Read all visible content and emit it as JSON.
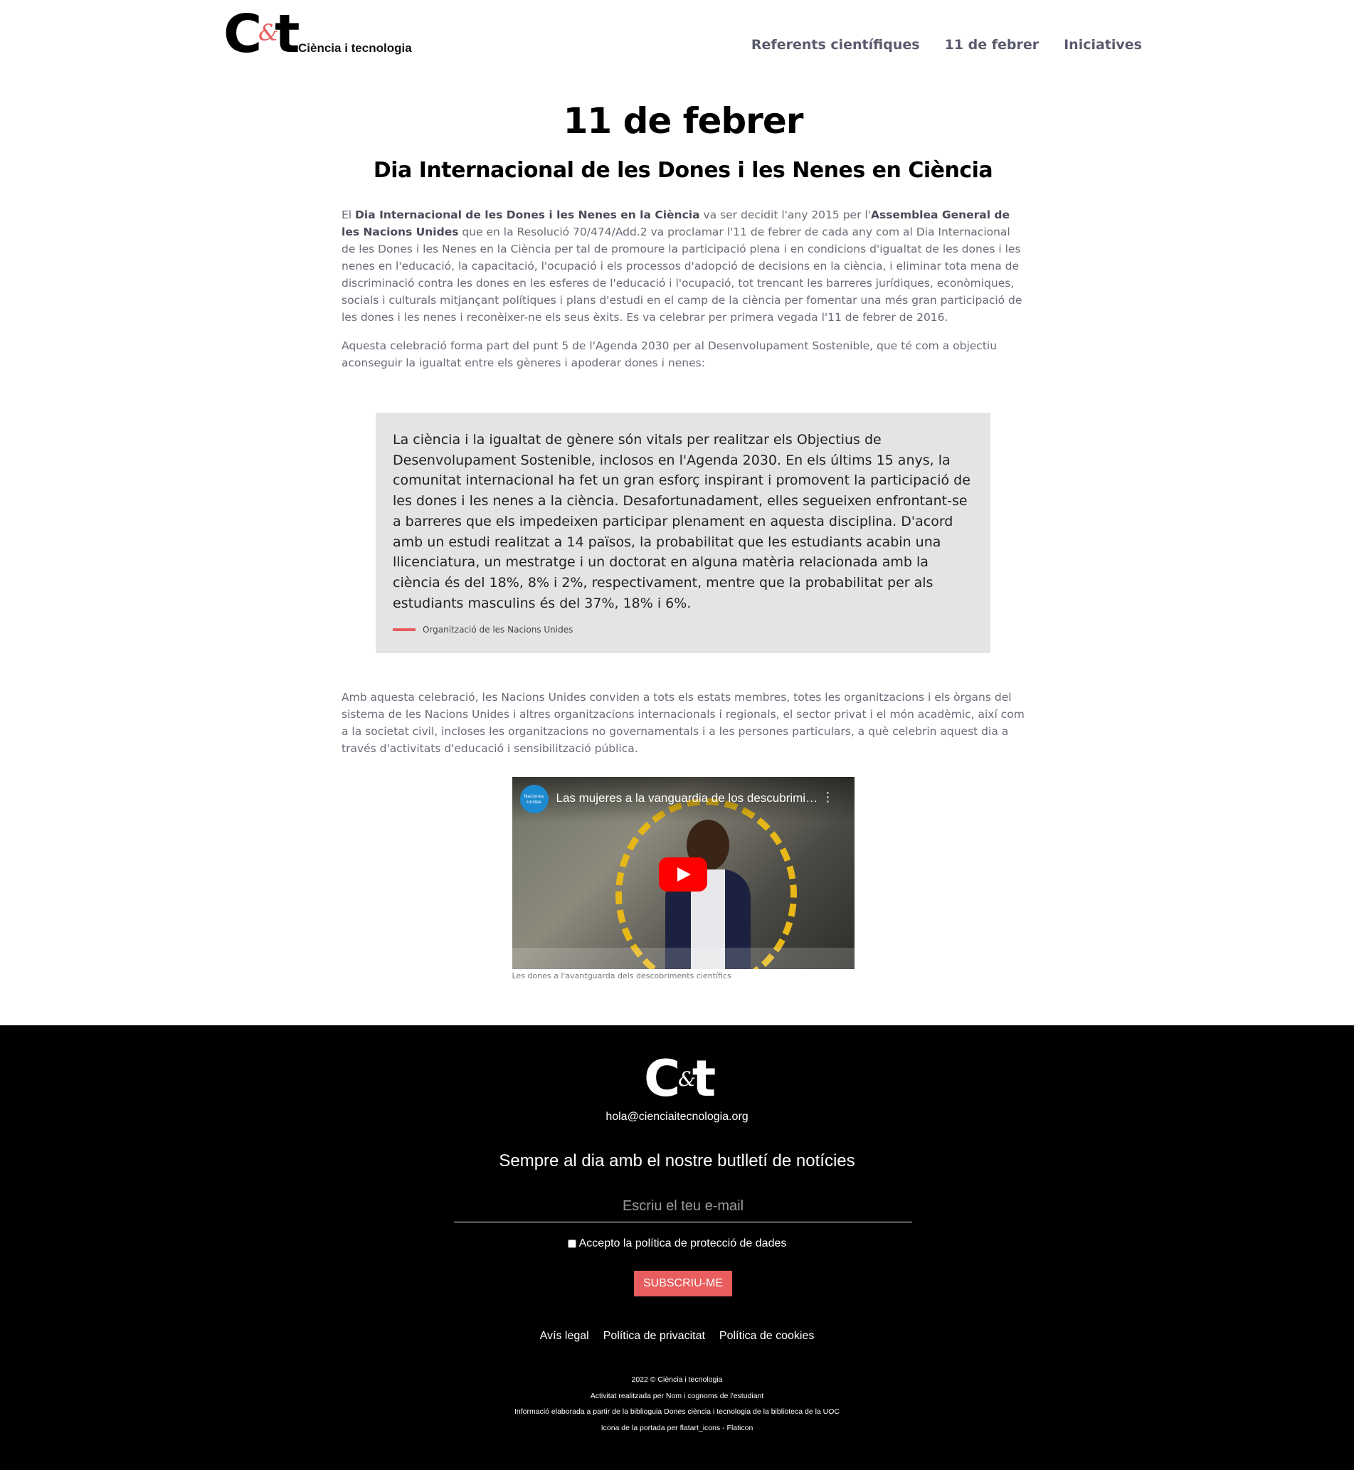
{
  "header": {
    "logo_text": "C&t",
    "logo_tagline": "Ciència i tecnologia",
    "nav": [
      {
        "label": "Referents científiques"
      },
      {
        "label": "11 de febrer"
      },
      {
        "label": "Iniciatives"
      }
    ]
  },
  "main": {
    "title": "11 de febrer",
    "subtitle": "Dia Internacional de les Dones i les Nenes en Ciència",
    "p1": {
      "t1": "El ",
      "b1": "Dia Internacional de les Dones i les Nenes en la Ciència",
      "t2": " va ser decidit l'any 2015 per l'",
      "b2": "Assemblea General de les Nacions Unides",
      "t3": " que en la Resolució 70/474/Add.2 va proclamar l'11 de febrer de cada any com al Dia Internacional de les Dones i les Nenes en la Ciència per tal de promoure la participació plena i en condicions d'igualtat de les dones i les nenes en l'educació, la capacitació, l'ocupació i els processos d'adopció de decisions en la ciència, i eliminar tota mena de discriminació contra les dones en les esferes de l'educació i l'ocupació, tot trencant les barreres jurídiques, econòmiques, socials i culturals mitjançant polítiques i plans d'estudi en el camp de la ciència per fomentar una més gran participació de les dones i les nenes i reconèixer-ne els seus èxits. Es va celebrar per primera vegada l'11 de febrer de 2016."
    },
    "p2": "Aquesta celebració forma part del punt 5 de l'Agenda 2030 per al Desenvolupament Sostenible, que té com a objectiu aconseguir la igualtat entre els gèneres i apoderar dones i nenes:",
    "quote": {
      "text": "La ciència i la igualtat de gènere són vitals per realitzar els Objectius de Desenvolupament Sostenible, inclosos en l'Agenda 2030. En els últims 15 anys, la comunitat internacional ha fet un gran esforç inspirant i promovent la participació de les dones i les nenes a la ciència. Desafortunadament, elles segueixen enfrontant-se a barreres que els impedeixen participar plenament en aquesta disciplina. D'acord amb un estudi realitzat a 14 països, la probabilitat que les estudiants acabin una llicenciatura, un mestratge i un doctorat en alguna matèria relacionada amb la ciència és del 18%, 8% i 2%, respectivament, mentre que la probabilitat per als estudiants masculins és del 37%, 18% i 6%.",
      "source": "Organització de les Nacions Unides"
    },
    "p3": "Amb aquesta celebració, les Nacions Unides conviden a tots els estats membres, totes les organitzacions i els òrgans del sistema de les Nacions Unides i altres organitzacions internacionals i regionals, el sector privat i el món acadèmic, així com a la societat civil, incloses les organitzacions no governamentals i a les persones particulars, a què celebrin aquest dia a través d'activitats d'educació i sensibilització pública.",
    "video": {
      "title": "Las mujeres a la vanguardia de los descubrimientos científicos",
      "channel_logo": "Naciones Unidas",
      "caption": "Les dones a l'avantguarda dels descobriments científics"
    }
  },
  "footer": {
    "logo_text": "C&t",
    "email": "hola@cienciaitecnologia.org",
    "newsletter_heading": "Sempre al dia amb el nostre butlletí de notícies",
    "email_placeholder": "Escriu el teu e-mail",
    "consent_label": "Accepto la política de protecció de dades",
    "subscribe_label": "SUBSCRIU-ME",
    "links": [
      {
        "label": "Avís legal"
      },
      {
        "label": "Política de privacitat"
      },
      {
        "label": "Política de cookies"
      }
    ],
    "credits": [
      "2022 © Ciència i tecnologia",
      "Activitat realitzada per Nom i cognoms de l'estudiant",
      "Informació elaborada a partir de la biblioguia Dones ciència i tecnologia de la biblioteca de la UOC",
      "Icona de la portada per flatart_icons - Flaticon"
    ]
  },
  "colors": {
    "accent": "#e85d5d",
    "text": "#6b6b78",
    "quote_bg": "#e4e4e6",
    "footer_bg": "#000000"
  }
}
